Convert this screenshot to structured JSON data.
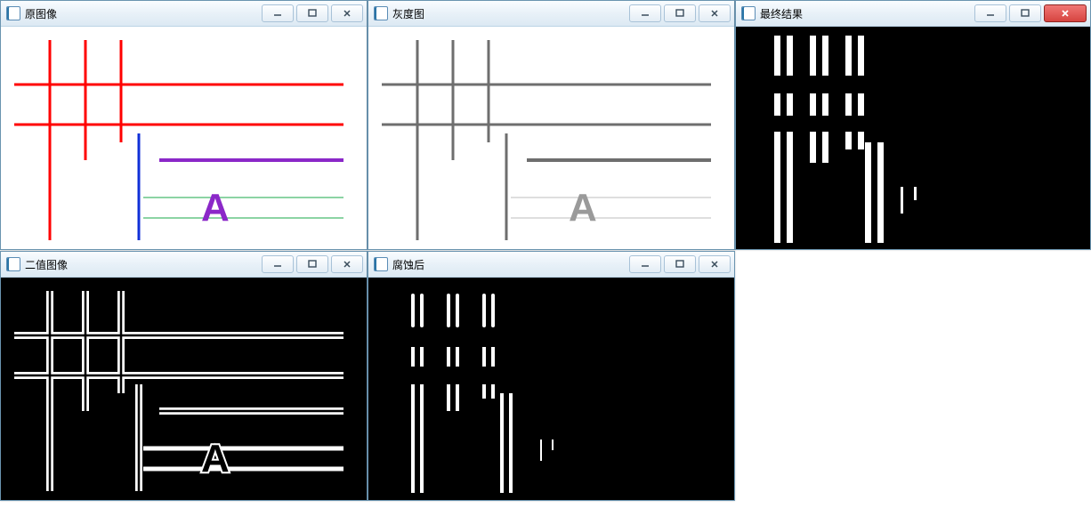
{
  "windows": {
    "original": {
      "title": "原图像"
    },
    "grayscale": {
      "title": "灰度图"
    },
    "final": {
      "title": "最终结果"
    },
    "binary": {
      "title": "二值图像"
    },
    "eroded": {
      "title": "腐蚀后"
    }
  },
  "buttons": {
    "min": "–",
    "max": "▢",
    "close": "✕"
  },
  "drawing": {
    "letter": "A",
    "colors": {
      "red": "#ff0000",
      "blue": "#1030d8",
      "purple": "#8b28c8",
      "green": "#1aa84a",
      "gray": "#6e6e6e",
      "white": "#ffffff",
      "black": "#000000"
    }
  }
}
